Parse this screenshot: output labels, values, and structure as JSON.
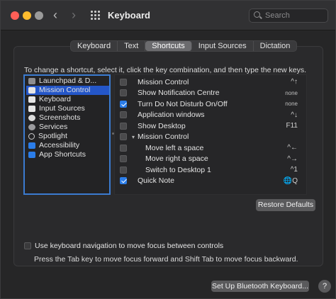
{
  "window": {
    "title": "Keyboard",
    "nav_back": "‹",
    "nav_forward": "›"
  },
  "search": {
    "placeholder": "Search"
  },
  "tabs": [
    {
      "label": "Keyboard",
      "active": false
    },
    {
      "label": "Text",
      "active": false
    },
    {
      "label": "Shortcuts",
      "active": true
    },
    {
      "label": "Input Sources",
      "active": false
    },
    {
      "label": "Dictation",
      "active": false
    }
  ],
  "instruction": "To change a shortcut, select it, click the key combination, and then type the new keys.",
  "categories": [
    {
      "label": "Launchpad & D...",
      "icon": "launchpad-icon",
      "selected": false
    },
    {
      "label": "Mission Control",
      "icon": "mission-control-icon",
      "selected": true
    },
    {
      "label": "Keyboard",
      "icon": "keyboard-icon",
      "selected": false
    },
    {
      "label": "Input Sources",
      "icon": "input-sources-icon",
      "selected": false
    },
    {
      "label": "Screenshots",
      "icon": "screenshots-icon",
      "selected": false
    },
    {
      "label": "Services",
      "icon": "services-gear-icon",
      "selected": false
    },
    {
      "label": "Spotlight",
      "icon": "spotlight-icon",
      "selected": false
    },
    {
      "label": "Accessibility",
      "icon": "accessibility-icon",
      "selected": false
    },
    {
      "label": "App Shortcuts",
      "icon": "app-shortcuts-icon",
      "selected": false
    }
  ],
  "shortcuts": [
    {
      "label": "Mission Control",
      "key": "^↑",
      "checked": false,
      "indent": false,
      "group": false
    },
    {
      "label": "Show Notification Centre",
      "key": "none",
      "checked": false,
      "indent": false,
      "group": false
    },
    {
      "label": "Turn Do Not Disturb On/Off",
      "key": "none",
      "checked": true,
      "indent": false,
      "group": false
    },
    {
      "label": "Application windows",
      "key": "^↓",
      "checked": false,
      "indent": false,
      "group": false
    },
    {
      "label": "Show Desktop",
      "key": "F11",
      "checked": false,
      "indent": false,
      "group": false
    },
    {
      "label": "Mission Control",
      "key": "",
      "checked": false,
      "indent": false,
      "group": true
    },
    {
      "label": "Move left a space",
      "key": "^←",
      "checked": false,
      "indent": true,
      "group": false
    },
    {
      "label": "Move right a space",
      "key": "^→",
      "checked": false,
      "indent": true,
      "group": false
    },
    {
      "label": "Switch to Desktop 1",
      "key": "^1",
      "checked": false,
      "indent": true,
      "group": false
    },
    {
      "label": "Quick Note",
      "key": "🌐Q",
      "checked": true,
      "indent": false,
      "group": false
    }
  ],
  "restore_defaults": "Restore Defaults",
  "keyboard_navigation": {
    "label": "Use keyboard navigation to move focus between controls",
    "hint": "Press the Tab key to move focus forward and Shift Tab to move focus backward.",
    "checked": false
  },
  "bluetooth_button": "Set Up Bluetooth Keyboard...",
  "help_button": "?",
  "colors": {
    "accent": "#2b7de9",
    "selection": "#2456c8",
    "close": "#ff5f57",
    "minimize": "#febc2e"
  }
}
